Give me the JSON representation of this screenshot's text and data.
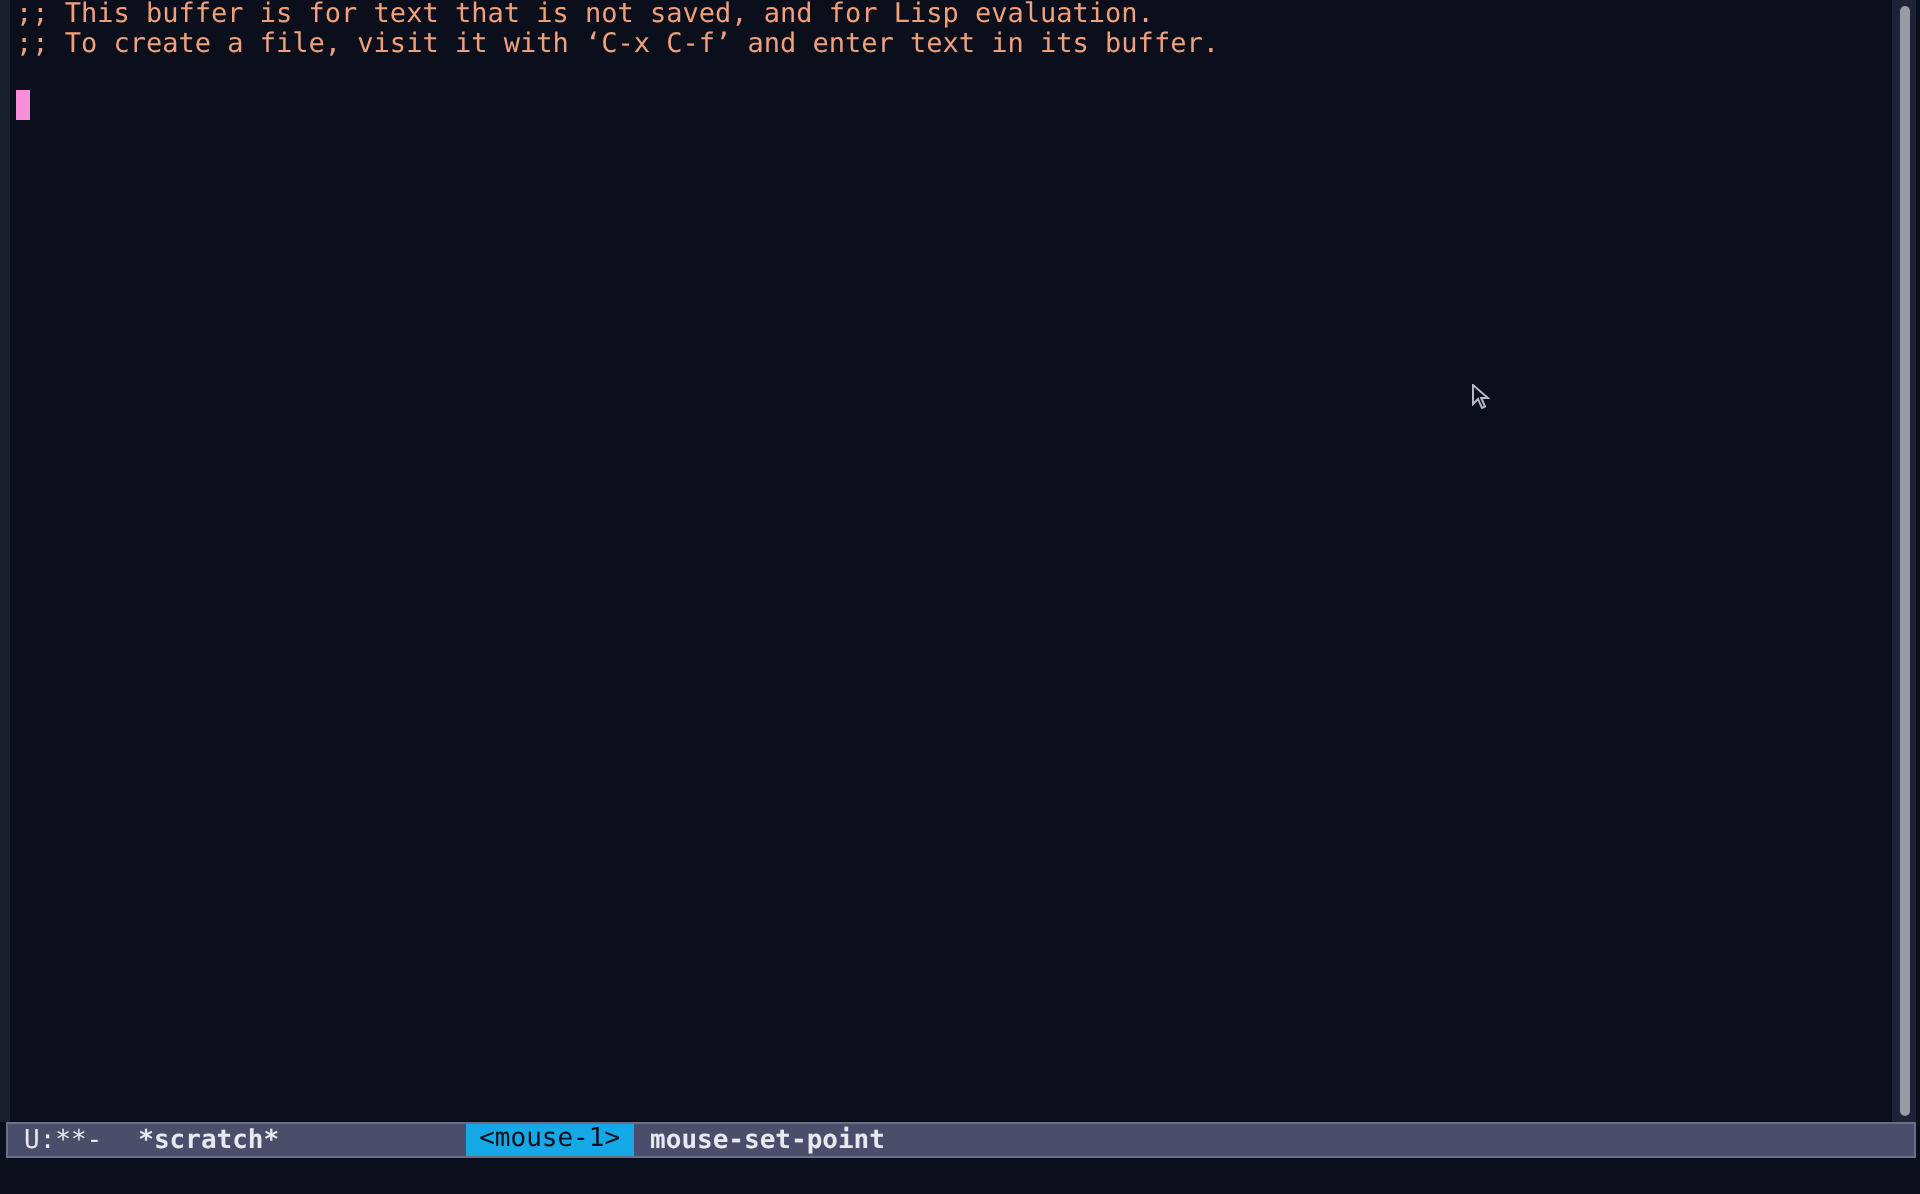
{
  "buffer": {
    "lines": [
      ";; This buffer is for text that is not saved, and for Lisp evaluation.",
      ";; To create a file, visit it with ‘C-x C-f’ and enter text in its buffer."
    ]
  },
  "mode_line": {
    "status": "U:**-",
    "buffer_name": "*scratch*",
    "key": "<mouse-1>",
    "command": "mouse-set-point"
  }
}
